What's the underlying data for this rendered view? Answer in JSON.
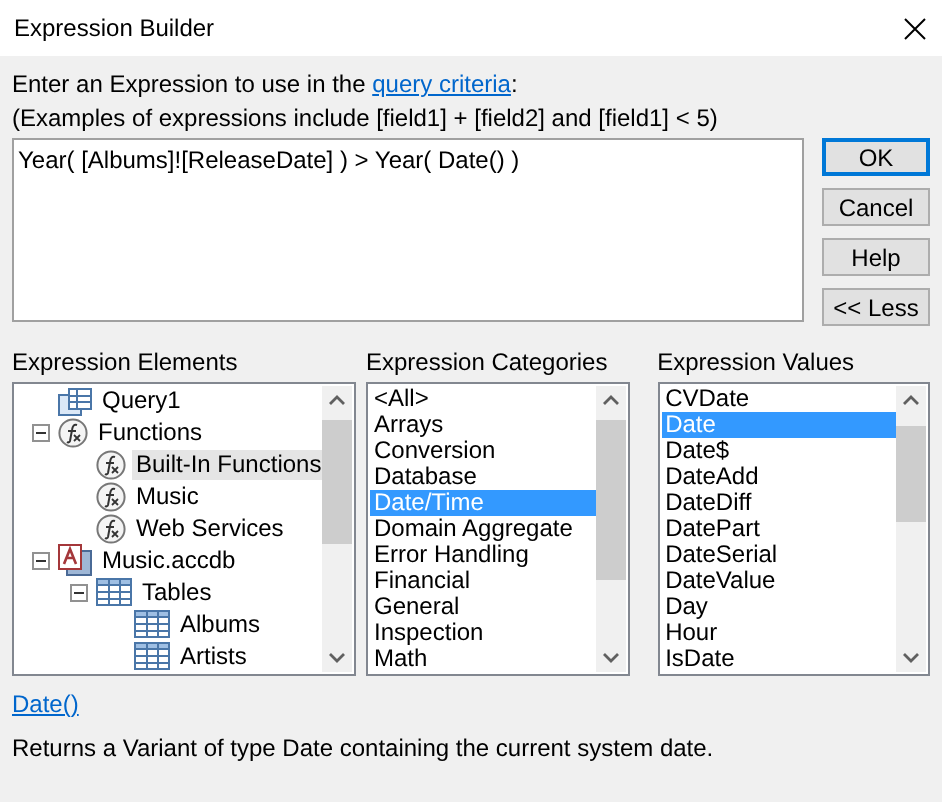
{
  "window": {
    "title": "Expression Builder"
  },
  "prompt": {
    "before": "Enter an Expression to use in the ",
    "link": "query criteria",
    "after": ":"
  },
  "examples": "(Examples of expressions include [field1] + [field2] and [field1] < 5)",
  "expression": {
    "value": "Year( [Albums]![ReleaseDate] ) > Year( Date() )"
  },
  "buttons": [
    {
      "label": "OK",
      "default": true
    },
    {
      "label": "Cancel",
      "default": false
    },
    {
      "label": "Help",
      "default": false
    },
    {
      "label": "<< Less",
      "default": false
    }
  ],
  "elements": {
    "heading": "Expression Elements",
    "items": [
      {
        "label": "Query1",
        "kind": "query",
        "selected": false
      },
      {
        "label": "Functions",
        "kind": "function",
        "selected": false,
        "expanded": true,
        "children": [
          {
            "label": "Built-In Functions",
            "kind": "function",
            "selected": true
          },
          {
            "label": "Music",
            "kind": "function",
            "selected": false
          },
          {
            "label": "Web Services",
            "kind": "function",
            "selected": false
          }
        ]
      },
      {
        "label": "Music.accdb",
        "kind": "database",
        "selected": false,
        "expanded": true,
        "children": [
          {
            "label": "Tables",
            "kind": "table",
            "selected": false,
            "expanded": true,
            "children": [
              {
                "label": "Albums",
                "kind": "table",
                "selected": false
              },
              {
                "label": "Artists",
                "kind": "table",
                "selected": false
              }
            ]
          }
        ]
      }
    ]
  },
  "categories": {
    "heading": "Expression Categories",
    "items": [
      {
        "label": "<All>",
        "selected": false
      },
      {
        "label": "Arrays",
        "selected": false
      },
      {
        "label": "Conversion",
        "selected": false
      },
      {
        "label": "Database",
        "selected": false
      },
      {
        "label": "Date/Time",
        "selected": true
      },
      {
        "label": "Domain Aggregate",
        "selected": false
      },
      {
        "label": "Error Handling",
        "selected": false
      },
      {
        "label": "Financial",
        "selected": false
      },
      {
        "label": "General",
        "selected": false
      },
      {
        "label": "Inspection",
        "selected": false
      },
      {
        "label": "Math",
        "selected": false
      }
    ]
  },
  "values": {
    "heading": "Expression Values",
    "items": [
      {
        "label": "CVDate",
        "selected": false
      },
      {
        "label": "Date",
        "selected": true
      },
      {
        "label": "Date$",
        "selected": false
      },
      {
        "label": "DateAdd",
        "selected": false
      },
      {
        "label": "DateDiff",
        "selected": false
      },
      {
        "label": "DatePart",
        "selected": false
      },
      {
        "label": "DateSerial",
        "selected": false
      },
      {
        "label": "DateValue",
        "selected": false
      },
      {
        "label": "Day",
        "selected": false
      },
      {
        "label": "Hour",
        "selected": false
      },
      {
        "label": "IsDate",
        "selected": false
      }
    ]
  },
  "syntax_link": "Date()",
  "description": "Returns a Variant of type Date containing the current system date."
}
